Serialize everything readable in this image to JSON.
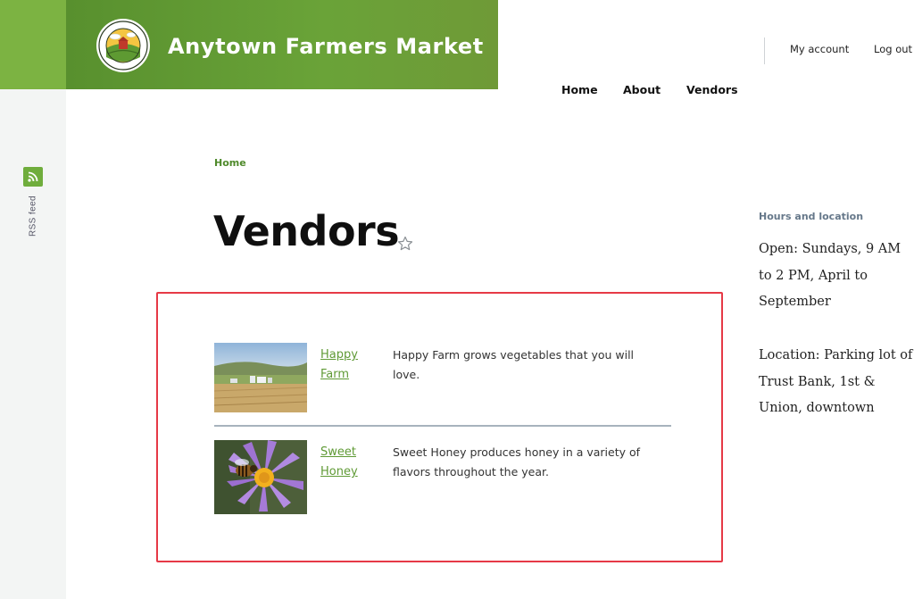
{
  "site": {
    "name": "Anytown Farmers Market",
    "logo": {
      "ring_text_top": "ANYTOWN FARMERS MARKET",
      "ring_text_bottom": "FARM FRESH FOOD"
    }
  },
  "nav": {
    "items": [
      {
        "label": "Home"
      },
      {
        "label": "About"
      },
      {
        "label": "Vendors"
      }
    ],
    "account": [
      {
        "label": "My account"
      },
      {
        "label": "Log out"
      }
    ]
  },
  "rail": {
    "rss_label": "RSS feed"
  },
  "breadcrumb": {
    "home": "Home"
  },
  "page": {
    "title": "Vendors"
  },
  "vendors": [
    {
      "name": "Happy Farm",
      "description": "Happy Farm grows vegetables that you will love."
    },
    {
      "name": "Sweet Honey",
      "description": "Sweet Honey produces honey in a variety of flavors throughout the year."
    }
  ],
  "sidebar": {
    "title": "Hours and location",
    "hours": "Open: Sundays, 9 AM to 2 PM, April to September",
    "location": "Location: Parking lot of Trust Bank, 1st & Union, downtown"
  },
  "colors": {
    "brand_green": "#6aa338",
    "link_green": "#5f9a35",
    "highlight_red": "#e63946"
  }
}
